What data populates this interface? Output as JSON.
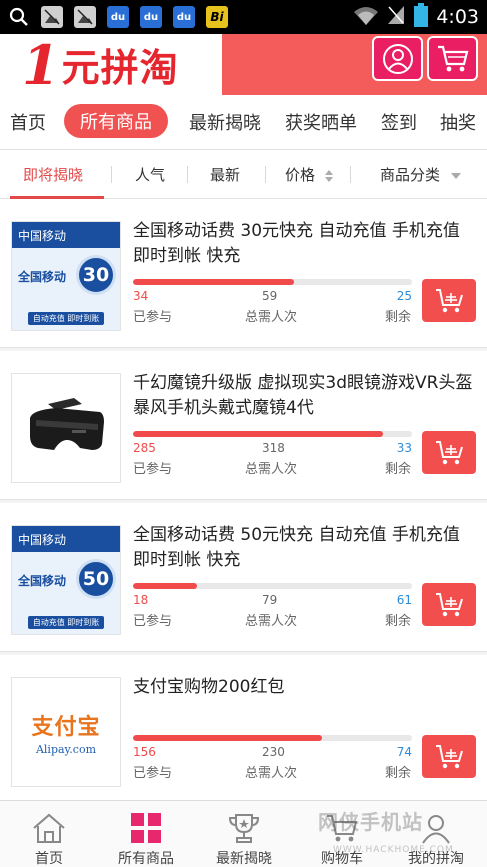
{
  "status_bar": {
    "time": "4:03",
    "notification_icons": [
      "search-icon",
      "gallery-icon",
      "gallery-icon",
      "baidu-paw-icon",
      "baidu-paw-icon",
      "baidu-paw-icon",
      "bi-icon"
    ],
    "bi_text": "Bi",
    "du_text": "du"
  },
  "header": {
    "logo_number": "1",
    "logo_text": "元拼淘",
    "brand_color": "#e6262f",
    "header_color": "#f45b5b",
    "button_color": "#ea1e63"
  },
  "nav_tabs": {
    "items": [
      {
        "label": "首页"
      },
      {
        "label": "所有商品"
      },
      {
        "label": "最新揭晓"
      },
      {
        "label": "获奖晒单"
      },
      {
        "label": "签到"
      },
      {
        "label": "抽奖"
      }
    ],
    "active_index": 1
  },
  "sort_bar": {
    "items": [
      {
        "label": "即将揭晓"
      },
      {
        "label": "人气"
      },
      {
        "label": "最新"
      },
      {
        "label": "价格"
      },
      {
        "label": "商品分类"
      }
    ],
    "active_index": 0
  },
  "products": [
    {
      "title": "全国移动话费 30元快充 自动充值 手机充值 即时到帐 快充",
      "joined": "34",
      "total": "59",
      "remaining": "25",
      "progress": 0.576,
      "thumb": {
        "type": "cmcc",
        "head": "中国移动",
        "text": "全国移动",
        "amount": "30",
        "foot": "自动充值 即时到账"
      }
    },
    {
      "title": "千幻魔镜升级版 虚拟现实3d眼镜游戏VR头盔暴风手机头戴式魔镜4代",
      "joined": "285",
      "total": "318",
      "remaining": "33",
      "progress": 0.896,
      "thumb": {
        "type": "vr"
      }
    },
    {
      "title": "全国移动话费 50元快充 自动充值 手机充值 即时到帐 快充",
      "joined": "18",
      "total": "79",
      "remaining": "61",
      "progress": 0.228,
      "thumb": {
        "type": "cmcc",
        "head": "中国移动",
        "text": "全国移动",
        "amount": "50",
        "foot": "自动充值 即时到账"
      }
    },
    {
      "title": "支付宝购物200红包",
      "joined": "156",
      "total": "230",
      "remaining": "74",
      "progress": 0.678,
      "thumb": {
        "type": "alipay",
        "cn": "支付宝",
        "en": "Alipay.com"
      }
    }
  ],
  "labels": {
    "joined": "已参与",
    "total": "总需人次",
    "remaining": "剩余"
  },
  "bottom_nav": {
    "items": [
      {
        "label": "首页",
        "icon": "home-icon"
      },
      {
        "label": "所有商品",
        "icon": "grid-icon"
      },
      {
        "label": "最新揭晓",
        "icon": "trophy-icon"
      },
      {
        "label": "购物车",
        "icon": "cart-icon"
      },
      {
        "label": "我的拼淘",
        "icon": "user-icon"
      }
    ],
    "active_index": 1
  },
  "watermark": {
    "text": "网侠手机站",
    "sub": "WWW.HACKHOME.COM"
  }
}
